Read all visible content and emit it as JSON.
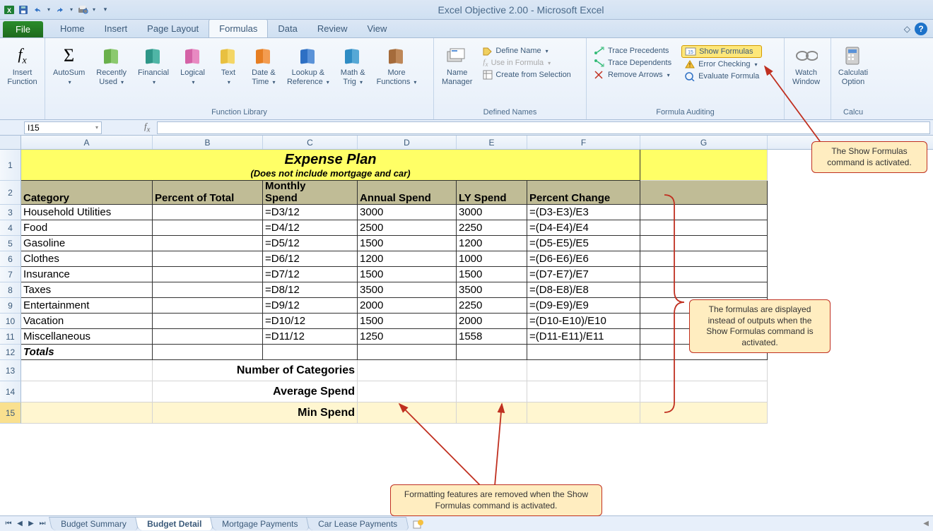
{
  "title": "Excel Objective 2.00  -  Microsoft Excel",
  "file_tab": "File",
  "tabs": [
    "Home",
    "Insert",
    "Page Layout",
    "Formulas",
    "Data",
    "Review",
    "View"
  ],
  "active_tab": "Formulas",
  "ribbon": {
    "insert_function": "Insert\nFunction",
    "autosum": "AutoSum",
    "recently_used": "Recently\nUsed",
    "financial": "Financial",
    "logical": "Logical",
    "text": "Text",
    "date_time": "Date &\nTime",
    "lookup_ref": "Lookup &\nReference",
    "math_trig": "Math &\nTrig",
    "more_functions": "More\nFunctions",
    "group_function_library": "Function Library",
    "name_manager": "Name\nManager",
    "define_name": "Define Name",
    "use_in_formula": "Use in Formula",
    "create_from_selection": "Create from Selection",
    "group_defined_names": "Defined Names",
    "trace_precedents": "Trace Precedents",
    "trace_dependents": "Trace Dependents",
    "remove_arrows": "Remove Arrows",
    "show_formulas": "Show Formulas",
    "error_checking": "Error Checking",
    "evaluate_formula": "Evaluate Formula",
    "group_formula_auditing": "Formula Auditing",
    "watch_window": "Watch\nWindow",
    "calculation_options": "Calculati\nOption",
    "group_calc": "Calcu"
  },
  "namebox": "I15",
  "columns": [
    "A",
    "B",
    "C",
    "D",
    "E",
    "F",
    "G"
  ],
  "rowcount": 15,
  "sheet": {
    "title": "Expense Plan",
    "subtitle": "(Does not include mortgage and car)",
    "headers": [
      "Category",
      "Percent of Total",
      "Monthly\nSpend",
      "Annual Spend",
      "LY Spend",
      "Percent Change"
    ],
    "rows": [
      {
        "cat": "Household Utilities",
        "b": "",
        "c": "=D3/12",
        "d": "3000",
        "e": "3000",
        "f": "=(D3-E3)/E3"
      },
      {
        "cat": "Food",
        "b": "",
        "c": "=D4/12",
        "d": "2500",
        "e": "2250",
        "f": "=(D4-E4)/E4"
      },
      {
        "cat": "Gasoline",
        "b": "",
        "c": "=D5/12",
        "d": "1500",
        "e": "1200",
        "f": "=(D5-E5)/E5"
      },
      {
        "cat": "Clothes",
        "b": "",
        "c": "=D6/12",
        "d": "1200",
        "e": "1000",
        "f": "=(D6-E6)/E6"
      },
      {
        "cat": "Insurance",
        "b": "",
        "c": "=D7/12",
        "d": "1500",
        "e": "1500",
        "f": "=(D7-E7)/E7"
      },
      {
        "cat": "Taxes",
        "b": "",
        "c": "=D8/12",
        "d": "3500",
        "e": "3500",
        "f": "=(D8-E8)/E8"
      },
      {
        "cat": "Entertainment",
        "b": "",
        "c": "=D9/12",
        "d": "2000",
        "e": "2250",
        "f": "=(D9-E9)/E9"
      },
      {
        "cat": "Vacation",
        "b": "",
        "c": "=D10/12",
        "d": "1500",
        "e": "2000",
        "f": "=(D10-E10)/E10"
      },
      {
        "cat": "Miscellaneous",
        "b": "",
        "c": "=D11/12",
        "d": "1250",
        "e": "1558",
        "f": "=(D11-E11)/E11"
      }
    ],
    "totals": "Totals",
    "stats": [
      "Number of Categories",
      "Average Spend",
      "Min Spend"
    ]
  },
  "sheet_tabs": [
    "Budget Summary",
    "Budget Detail",
    "Mortgage Payments",
    "Car Lease Payments"
  ],
  "active_sheet_tab": "Budget Detail",
  "callouts": {
    "c1": "The Show Formulas command is activated.",
    "c2": "The formulas are displayed instead of outputs when the Show Formulas command is activated.",
    "c3": "Formatting features are removed when the Show Formulas command is activated."
  }
}
